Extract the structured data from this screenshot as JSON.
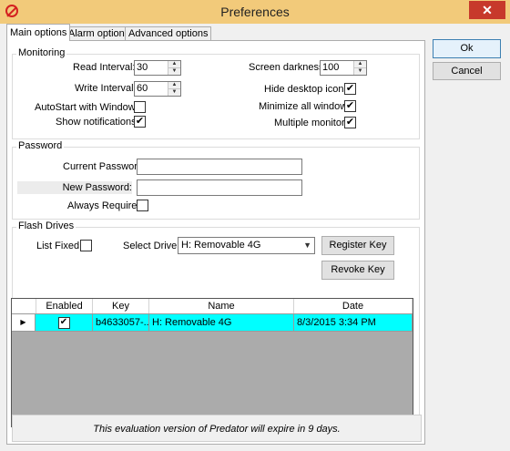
{
  "window": {
    "title": "Preferences",
    "close_glyph": "✕"
  },
  "tabs": [
    {
      "label": "Main options"
    },
    {
      "label": "Alarm options"
    },
    {
      "label": "Advanced options"
    }
  ],
  "dialog_buttons": {
    "ok": "Ok",
    "cancel": "Cancel"
  },
  "monitoring": {
    "title": "Monitoring",
    "read_interval_label": "Read Interval:",
    "read_interval_value": "30",
    "write_interval_label": "Write Interval:",
    "write_interval_value": "60",
    "autostart_label": "AutoStart with Windows:",
    "autostart_checked": false,
    "show_notifications_label": "Show notifications:",
    "show_notifications_checked": true,
    "screen_darkness_label": "Screen darkness:",
    "screen_darkness_value": "100",
    "hide_desktop_icons_label": "Hide desktop icons:",
    "hide_desktop_icons_checked": true,
    "minimize_all_label": "Minimize all windows:",
    "minimize_all_checked": true,
    "multiple_monitors_label": "Multiple monitors:",
    "multiple_monitors_checked": true
  },
  "password": {
    "title": "Password",
    "current_label": "Current Password:",
    "current_value": "",
    "new_label": "New Password:",
    "new_value": "",
    "always_required_label": "Always Required:",
    "always_required_checked": false
  },
  "flash_drives": {
    "title": "Flash Drives",
    "list_fixed_label": "List Fixed:",
    "list_fixed_checked": false,
    "select_drive_label": "Select Drive:",
    "select_drive_value": "H: Removable 4G",
    "register_key_button": "Register Key",
    "revoke_key_button": "Revoke Key",
    "table": {
      "columns": [
        "Enabled",
        "Key",
        "Name",
        "Date"
      ],
      "rows": [
        {
          "enabled": true,
          "key": "b4633057-...",
          "name": "H: Removable 4G",
          "date": "8/3/2015 3:34 PM"
        }
      ]
    }
  },
  "footer_message": "This evaluation version of Predator will expire in 9 days.",
  "glyphs": {
    "check": "✔",
    "up": "▲",
    "down": "▼",
    "combo_arrow": "▼",
    "row_pointer": "▶"
  },
  "colors": {
    "titlebar": "#f2ca7a",
    "close": "#c7392b",
    "selected_row": "#00ffff",
    "grid_bg": "#ababab"
  }
}
